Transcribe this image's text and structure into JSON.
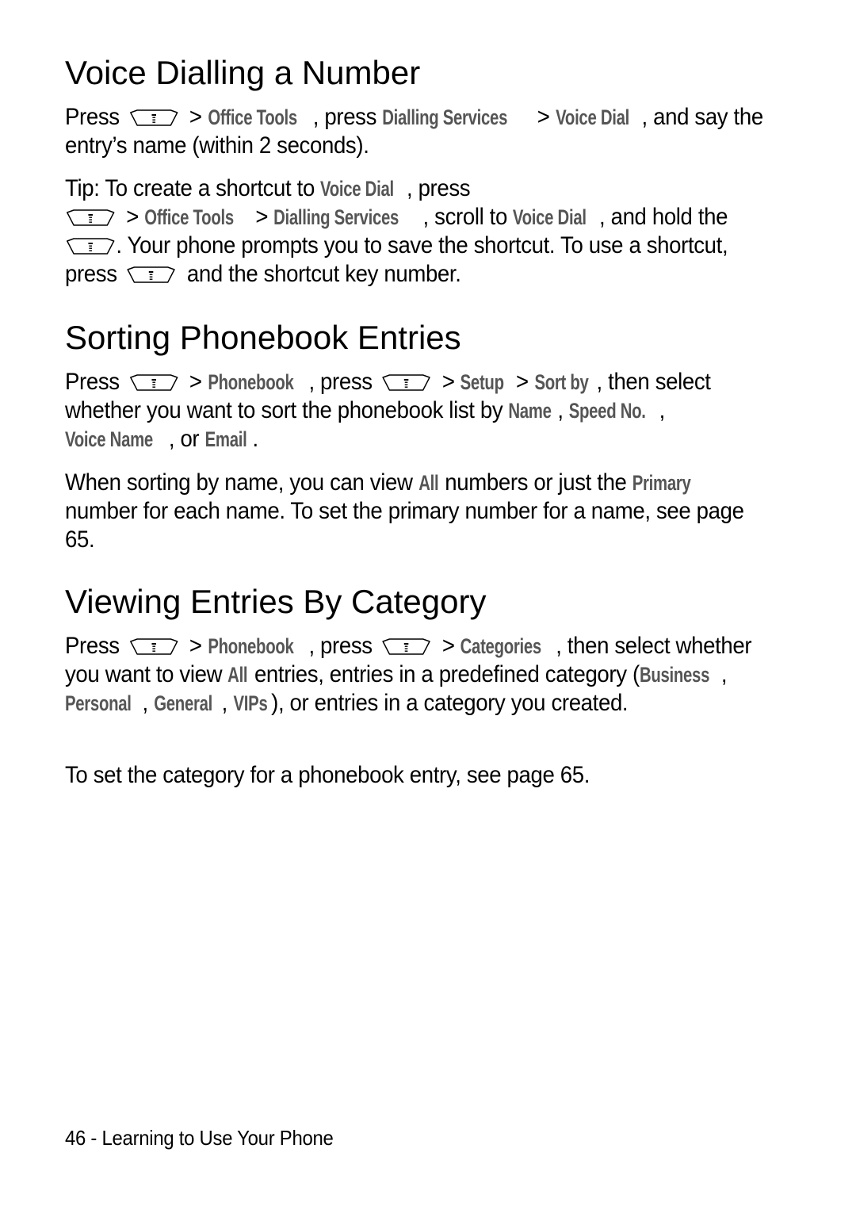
{
  "sections": [
    {
      "title": "Voice Dialling a Number",
      "p1": {
        "t0": "Press",
        "t1": ">",
        "m1": "Office Tools",
        "t2": ", press",
        "m2": "Dialling Services",
        "t3": ">",
        "m3": "Voice Dial",
        "t4": ", and say the entry’s name (within 2 seconds)."
      },
      "tip": {
        "t0": "Tip: To create a shortcut to",
        "m1": "Voice Dial",
        "t1": ", press",
        "t2": ">",
        "m2": "Office Tools",
        "t3": ">",
        "m3": "Dialling Services",
        "t4": ", scroll to",
        "m4": "Voice Dial",
        "t5": ", and hold the",
        "t6": ". Your phone prompts you to save the shortcut. To use a shortcut, press",
        "t7": "and the shortcut key number."
      }
    },
    {
      "title": "Sorting Phonebook Entries",
      "p1": {
        "t0": "Press",
        "t1": ">",
        "m1": "Phonebook",
        "t2": ", press",
        "t3": ">",
        "m2": "Setup",
        "t4": ">",
        "m3": "Sort by",
        "t5": ", then select whether you want to sort the phonebook list by",
        "m4": "Name",
        "t6": ",",
        "m5": "Speed No.",
        "t7": ",",
        "m6": "Voice Name",
        "t8": ", or",
        "m7": "Email",
        "t9": "."
      },
      "p2": {
        "t0": "When sorting by name, you can view",
        "m1": "All",
        "t1": "numbers or just the",
        "m2": "Primary",
        "t2": "number for each name. To set the primary number for a name, see page 65."
      }
    },
    {
      "title": "Viewing Entries By Category",
      "p1": {
        "t0": "Press",
        "t1": ">",
        "m1": "Phonebook",
        "t2": ", press",
        "t3": ">",
        "m2": "Categories",
        "t4": ", then select whether you want to view",
        "m3": "All",
        "t5": "entries, entries in a predefined category (",
        "m4": "Business",
        "t6": ",",
        "m5": "Personal",
        "t7": ",",
        "m6": "General",
        "t8": ",",
        "m7": "VIPs",
        "t9": "), or entries in a category you created."
      },
      "p2": "To set the category for a phonebook entry, see page 65."
    }
  ],
  "icons": {
    "menu_key": "menu-key-icon"
  },
  "colors": {
    "menu_term": "#555555",
    "text": "#000000"
  },
  "footer": {
    "page_number": "46",
    "separator": " - ",
    "chapter": "Learning to Use Your Phone"
  }
}
